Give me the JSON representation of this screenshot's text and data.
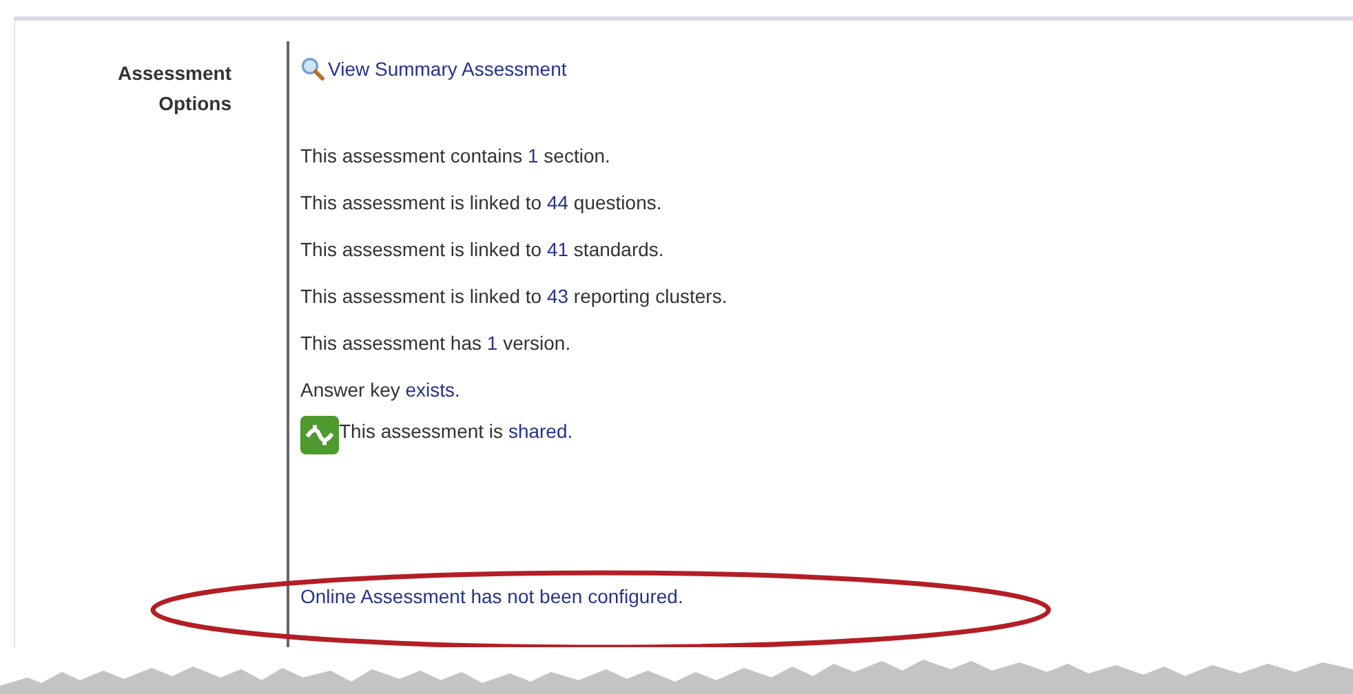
{
  "label": "Assessment Options",
  "summary_link": "View Summary Assessment",
  "lines": [
    {
      "kind": "text",
      "before": "This assessment contains ",
      "link": "1",
      "after": " section."
    },
    {
      "kind": "text",
      "before": "This assessment is linked to ",
      "link": "44",
      "after": " questions."
    },
    {
      "kind": "text",
      "before": "This assessment is linked to ",
      "link": "41",
      "after": " standards."
    },
    {
      "kind": "text",
      "before": "This assessment is linked to ",
      "link": "43",
      "after": " reporting clusters."
    },
    {
      "kind": "text",
      "before": "This assessment has ",
      "link": "1",
      "after": " version."
    },
    {
      "kind": "text",
      "before": "Answer key ",
      "link": "exists."
    },
    {
      "kind": "shared",
      "before": "This assessment is ",
      "link": "shared."
    },
    {
      "kind": "link",
      "link": "Online Assessment has not been configured."
    }
  ]
}
